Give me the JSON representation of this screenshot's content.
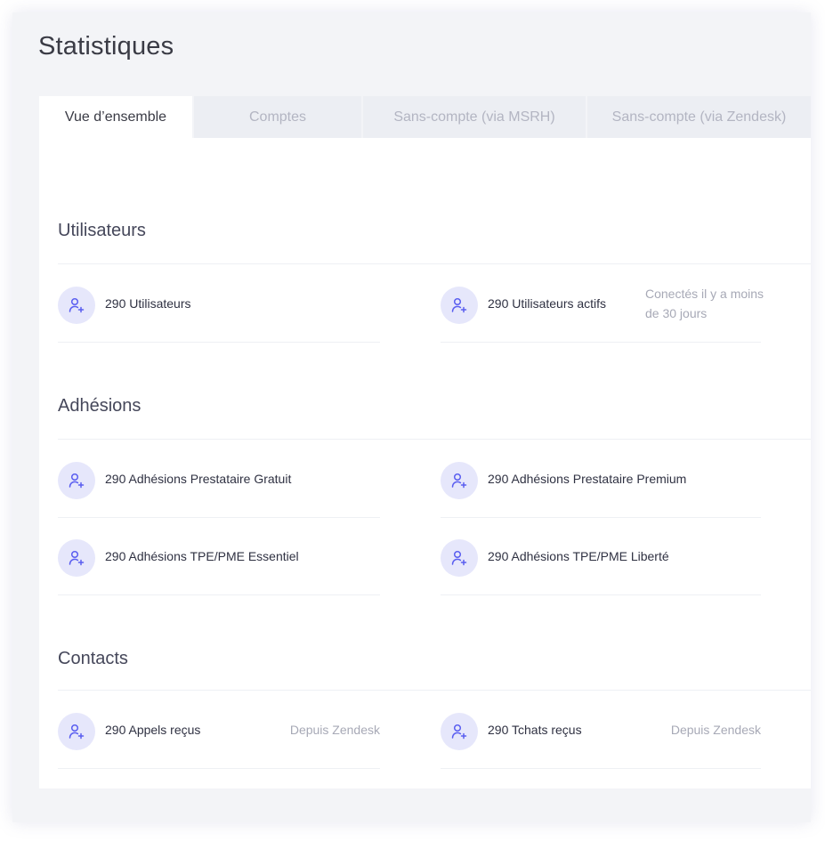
{
  "page": {
    "title": "Statistiques"
  },
  "tabs": [
    {
      "label": "Vue d’ensemble",
      "active": true
    },
    {
      "label": "Comptes",
      "active": false
    },
    {
      "label": "Sans-compte (via MSRH)",
      "active": false
    },
    {
      "label": "Sans-compte (via Zendesk)",
      "active": false
    }
  ],
  "colors": {
    "icon_bg": "#e6e7fb",
    "icon_fg": "#5a5ef0",
    "panel_bg": "#ffffff",
    "page_bg": "#f3f4f7"
  },
  "sections": {
    "utilisateurs": {
      "title": "Utilisateurs",
      "items": [
        {
          "icon": "user-plus-icon",
          "label": "290 Utilisateurs"
        },
        {
          "icon": "user-plus-icon",
          "label": "290 Utilisateurs actifs",
          "note": "Conectés il y a moins de 30 jours"
        }
      ]
    },
    "adhesions": {
      "title": "Adhésions",
      "items": [
        {
          "icon": "user-plus-icon",
          "label": "290 Adhésions Prestataire Gratuit"
        },
        {
          "icon": "user-plus-icon",
          "label": "290 Adhésions Prestataire Premium"
        },
        {
          "icon": "user-plus-icon",
          "label": "290 Adhésions TPE/PME Essentiel"
        },
        {
          "icon": "user-plus-icon",
          "label": "290 Adhésions TPE/PME Liberté"
        }
      ]
    },
    "contacts": {
      "title": "Contacts",
      "items": [
        {
          "icon": "user-plus-icon",
          "label": "290 Appels reçus",
          "note": "Depuis Zendesk"
        },
        {
          "icon": "user-plus-icon",
          "label": "290 Tchats reçus",
          "note": "Depuis Zendesk"
        }
      ]
    }
  }
}
